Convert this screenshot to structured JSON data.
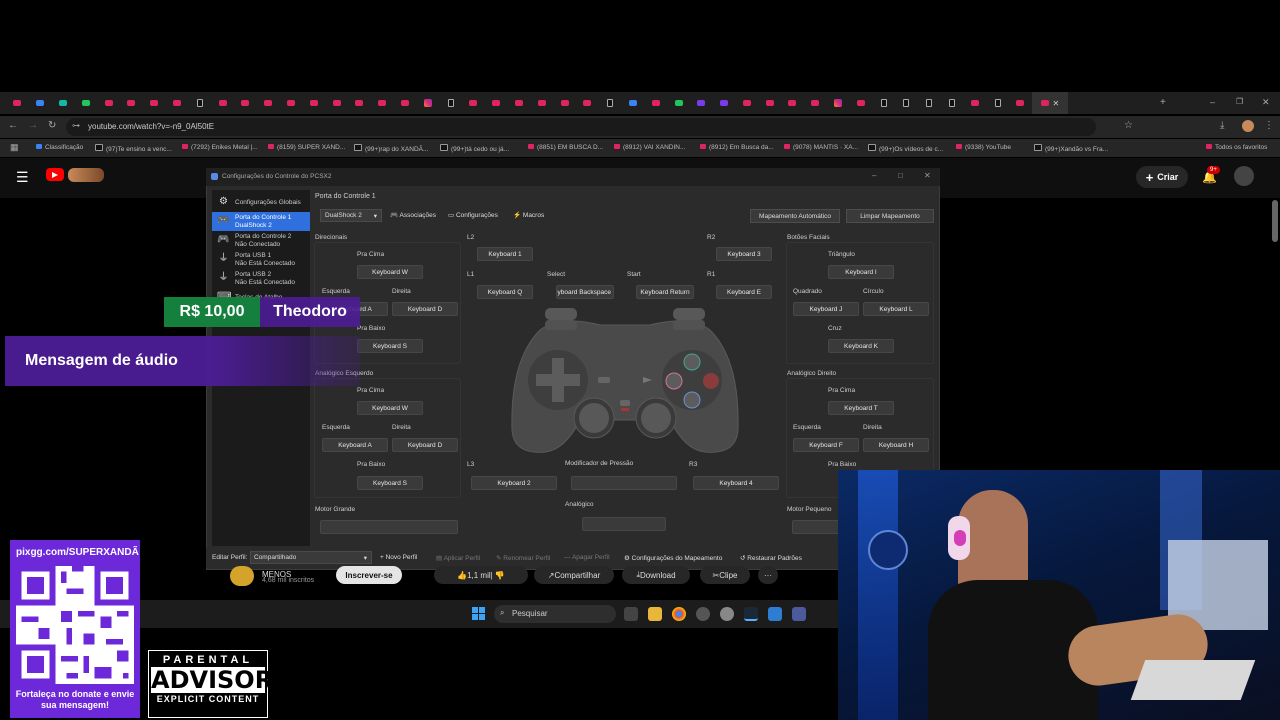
{
  "browser": {
    "url": "youtube.com/watch?v=-n9_0Al50tE",
    "bookmarks": [
      {
        "label": "Classificação",
        "kind": "blue"
      },
      {
        "label": "(97)Te ensino a venc...",
        "kind": "tk"
      },
      {
        "label": "(7292) Enikes Metal |...",
        "kind": "yt"
      },
      {
        "label": "(8159) SUPER XAND...",
        "kind": "yt"
      },
      {
        "label": "(99+)rap do XANDÃ...",
        "kind": "tk"
      },
      {
        "label": "(99+)tá cedo ou já...",
        "kind": "tk"
      },
      {
        "label": "(8851) EM BUSCA D...",
        "kind": "yt"
      },
      {
        "label": "(8912) VAI XANDIN...",
        "kind": "yt"
      },
      {
        "label": "(8912) Em Busca da...",
        "kind": "yt"
      },
      {
        "label": "(9078) MANTIS · XA...",
        "kind": "yt"
      },
      {
        "label": "(99+)Os vídeos de c...",
        "kind": "tk"
      },
      {
        "label": "(9338) YouTube",
        "kind": "yt"
      },
      {
        "label": "(99+)Xandão vs Fra...",
        "kind": "tk"
      }
    ],
    "all_bookmarks": "Todos os favoritos"
  },
  "youtube": {
    "create_label": "Criar",
    "notif_badge": "9+",
    "subscribe_label": "Inscrever-se",
    "subscribers": "4,68 mil inscritos",
    "channel_name": "MENOS",
    "likes": "1,1 mil",
    "share_label": "Compartilhar",
    "download_label": "Download",
    "clip_label": "Clipe",
    "more_label": "···"
  },
  "dialog": {
    "title": "Configurações do Controle do PCSX2",
    "sidebar": [
      {
        "label": "Configurações Globais",
        "sub": "",
        "icon": "⚙"
      },
      {
        "label": "Porta do Controle 1",
        "sub": "DualShock 2",
        "icon": "🎮"
      },
      {
        "label": "Porta do Controle 2",
        "sub": "Não Conectado",
        "icon": "🎮"
      },
      {
        "label": "Porta USB 1",
        "sub": "Não Está Conectado",
        "icon": "⏚"
      },
      {
        "label": "Porta USB 2",
        "sub": "Não Está Conectado",
        "icon": "⏚"
      },
      {
        "label": "Teclas de Atalho",
        "sub": "",
        "icon": "⌨"
      }
    ],
    "port_title": "Porta do Controle 1",
    "controller_type": "DualShock 2",
    "toolbar": {
      "bindings": "Associações",
      "settings": "Configurações",
      "macros": "Macros",
      "auto_map": "Mapeamento Automático",
      "clear_map": "Limpar Mapeamento"
    },
    "sections": {
      "dpad": "Direcionais",
      "face": "Botões Faciais",
      "left_analog": "Analógico Esquerdo",
      "right_analog": "Analógico Direito",
      "large_motor": "Motor Grande",
      "small_motor": "Motor Pequeno",
      "pressure": "Modificador de Pressão",
      "analog": "Analógico"
    },
    "labels": {
      "up": "Pra Cima",
      "down": "Pra Baixo",
      "left": "Esquerda",
      "right": "Direita",
      "triangle": "Triângulo",
      "square": "Quadrado",
      "circle": "Círculo",
      "cross": "Cruz",
      "l1": "L1",
      "l2": "L2",
      "r1": "R1",
      "r2": "R2",
      "l3": "L3",
      "r3": "R3",
      "select": "Select",
      "start": "Start"
    },
    "binds": {
      "dpad_up": "Keyboard W",
      "dpad_left": "Keyboard A",
      "dpad_right": "Keyboard D",
      "dpad_down": "Keyboard S",
      "la_up": "Keyboard W",
      "la_left": "Keyboard A",
      "la_right": "Keyboard D",
      "la_down": "Keyboard S",
      "l2": "Keyboard 1",
      "l1": "Keyboard Q",
      "r2": "Keyboard 3",
      "r1": "Keyboard E",
      "select": "Keyboard Backspace",
      "start": "Keyboard Return",
      "l3": "Keyboard 2",
      "r3": "Keyboard 4",
      "triangle": "Keyboard I",
      "square": "Keyboard J",
      "circle": "Keyboard L",
      "cross": "Keyboard K",
      "ra_up": "Keyboard T",
      "ra_left": "Keyboard F",
      "ra_right": "Keyboard H"
    },
    "footer": {
      "edit_profile": "Editar Perfil:",
      "profile_value": "Compartilhado",
      "new_profile": "Novo Perfil",
      "apply_profile": "Aplicar Perfil",
      "rename_profile": "Renomear Perfil",
      "delete_profile": "Apagar Perfil",
      "mapping_settings": "Configurações do Mapeamento",
      "restore_defaults": "Restaurar Padrões"
    }
  },
  "overlay": {
    "donation_amount": "R$ 10,00",
    "donor_name": "Theodoro",
    "message": "Mensagem de áudio",
    "pix_url": "pixgg.com/SUPERXANDÃ",
    "pix_message": "Fortaleça no donate e envie sua mensagem!",
    "parental_top": "PARENTAL",
    "parental_mid": "ADVISORY",
    "parental_bottom": "EXPLICIT CONTENT"
  },
  "taskbar": {
    "search_placeholder": "Pesquisar"
  },
  "colors": {
    "accent": "#2f6fde",
    "donation_green": "#15803d",
    "overlay_purple": "#4c1d95",
    "youtube_red": "#ff0000"
  }
}
